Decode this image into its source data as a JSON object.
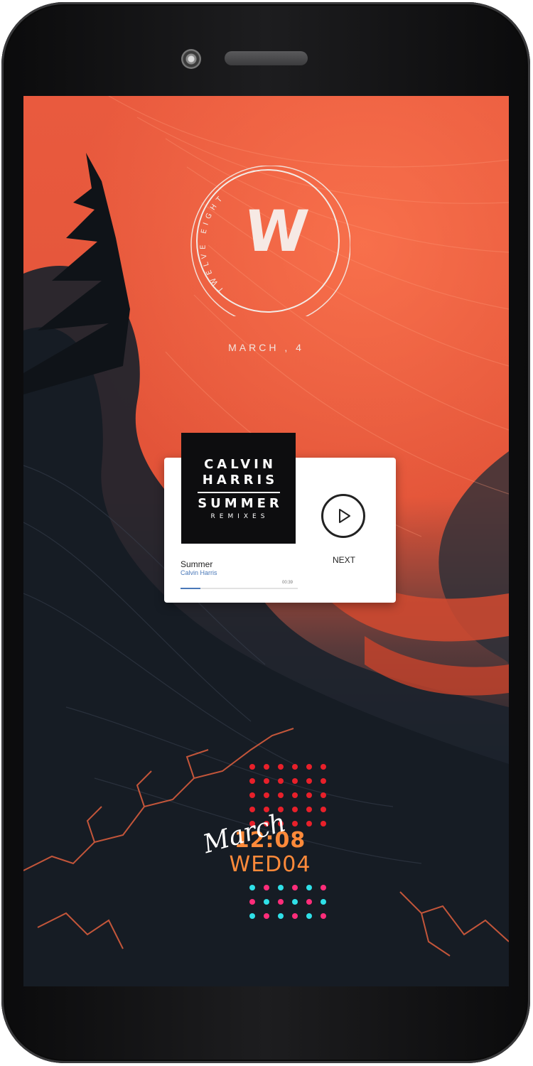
{
  "lockscreen": {
    "logo_mark": "W",
    "logo_ring_text": "TWELVE EIGHT",
    "date": "MARCH , 4"
  },
  "media_widget": {
    "album_art": {
      "line1": "CALVIN",
      "line2": "HARRIS",
      "line3": "SUMMER",
      "line4": "REMIXES"
    },
    "track_title": "Summer",
    "artist": "Calvin Harris",
    "elapsed": "00:39",
    "progress": 0.17,
    "next_label": "NEXT",
    "play_icon": "play-icon"
  },
  "clock_widget": {
    "time": "12:08",
    "day": "WED04",
    "month_script": "March"
  },
  "colors": {
    "accent_orange": "#ff8a3a",
    "red_dot": "#e8202a",
    "pink_dot": "#ff2d7a",
    "cyan_dot": "#2fe0e8",
    "wallpaper_orange": "#e2553a",
    "wallpaper_dark": "#1a2028",
    "artist_link": "#4a78b8"
  }
}
